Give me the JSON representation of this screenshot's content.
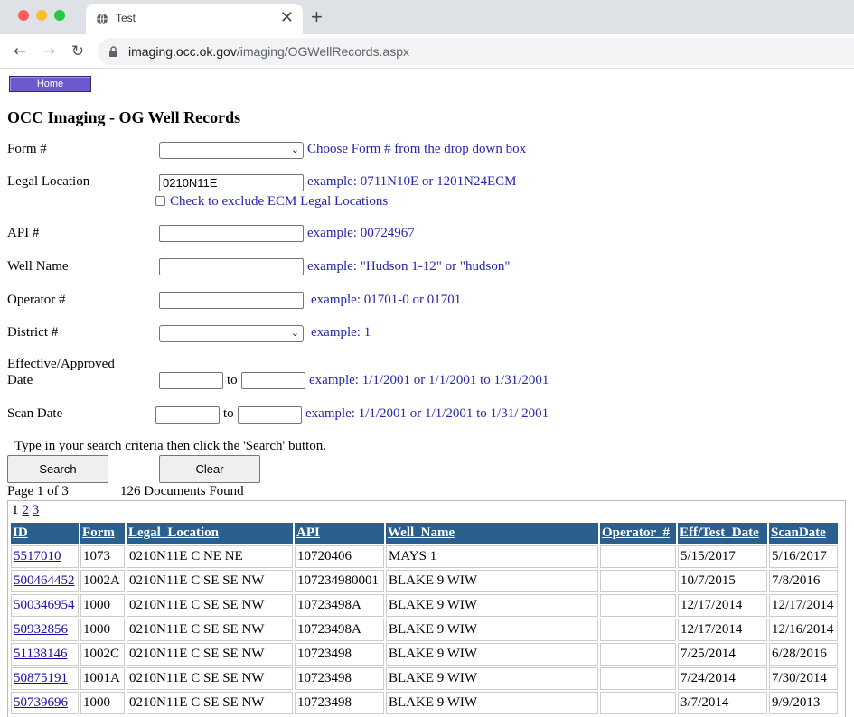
{
  "browser": {
    "tab_title": "Test",
    "url_host": "imaging.occ.ok.gov",
    "url_path": "/imaging/OGWellRecords.aspx"
  },
  "page": {
    "home_label": "Home",
    "title": "OCC Imaging - OG Well Records",
    "form": {
      "label": "Form #",
      "value": "",
      "hint": "Choose Form # from the drop down box"
    },
    "legal": {
      "label": "Legal Location",
      "value": "0210N11E",
      "hint": "example: 0711N10E or 1201N24ECM",
      "exclude_label": "Check to exclude ECM Legal Locations"
    },
    "api": {
      "label": "API #",
      "value": "",
      "hint": "example: 00724967"
    },
    "wellname": {
      "label": "Well Name",
      "value": "",
      "hint": "example: \"Hudson 1-12\" or \"hudson\""
    },
    "operator": {
      "label": "Operator #",
      "value": "",
      "hint": "example: 01701-0 or 01701"
    },
    "district": {
      "label": "District #",
      "value": "",
      "hint": "example: 1"
    },
    "effective": {
      "label_line1": "Effective/Approved",
      "label_line2": "Date",
      "from": "",
      "to_label": "to",
      "to": "",
      "hint": "example: 1/1/2001 or 1/1/2001 to 1/31/2001"
    },
    "scandate": {
      "label": "Scan Date",
      "from": "",
      "to_label": "to",
      "to": "",
      "hint": "example: 1/1/2001 or 1/1/2001 to 1/31/ 2001"
    },
    "instructions": "Type in your search criteria then click the 'Search' button.",
    "search_label": "Search",
    "clear_label": "Clear",
    "page_info": "Page 1 of 3",
    "doc_count": "126 Documents Found",
    "pages": [
      "1",
      "2",
      "3"
    ]
  },
  "results": {
    "columns": [
      "ID",
      "Form",
      "Legal_Location",
      "API",
      "Well_Name",
      "Operator_#",
      "Eff/Test_Date",
      "ScanDate"
    ],
    "rows": [
      [
        "5517010",
        "1073",
        "0210N11E C NE NE",
        "10720406",
        "MAYS 1",
        "",
        "5/15/2017",
        "5/16/2017"
      ],
      [
        "500464452",
        "1002A",
        "0210N11E C SE SE NW",
        "107234980001",
        "BLAKE 9 WIW",
        "",
        "10/7/2015",
        "7/8/2016"
      ],
      [
        "500346954",
        "1000",
        "0210N11E C SE SE NW",
        "10723498A",
        "BLAKE 9 WIW",
        "",
        "12/17/2014",
        "12/17/2014"
      ],
      [
        "50932856",
        "1000",
        "0210N11E C SE SE NW",
        "10723498A",
        "BLAKE 9 WIW",
        "",
        "12/17/2014",
        "12/16/2014"
      ],
      [
        "51138146",
        "1002C",
        "0210N11E C SE SE NW",
        "10723498",
        "BLAKE 9 WIW",
        "",
        "7/25/2014",
        "6/28/2016"
      ],
      [
        "50875191",
        "1001A",
        "0210N11E C SE SE NW",
        "10723498",
        "BLAKE 9 WIW",
        "",
        "7/24/2014",
        "7/30/2014"
      ],
      [
        "50739696",
        "1000",
        "0210N11E C SE SE NW",
        "10723498",
        "BLAKE 9 WIW",
        "",
        "3/7/2014",
        "9/9/2013"
      ]
    ]
  }
}
